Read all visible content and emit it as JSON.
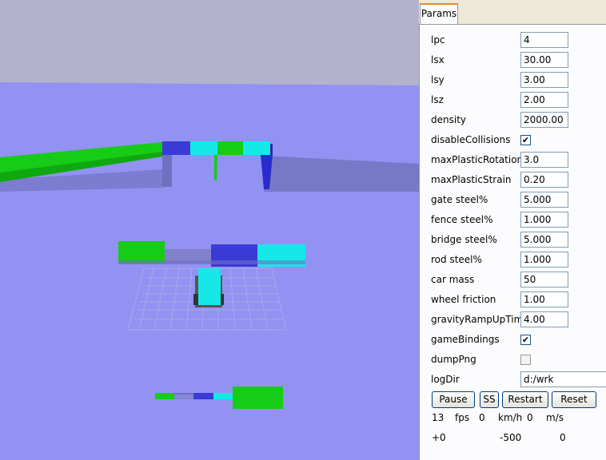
{
  "panel": {
    "tab_label": "Params",
    "params": [
      {
        "label": "lpc",
        "value": "4"
      },
      {
        "label": "lsx",
        "value": "30.00"
      },
      {
        "label": "lsy",
        "value": "3.00"
      },
      {
        "label": "lsz",
        "value": "2.00"
      },
      {
        "label": "density",
        "value": "2000.00"
      },
      {
        "label": "disableCollisions",
        "checked": true
      },
      {
        "label": "maxPlasticRotation",
        "value": "3.0"
      },
      {
        "label": "maxPlasticStrain",
        "value": "0.20"
      },
      {
        "label": "gate steel%",
        "value": "5.000"
      },
      {
        "label": "fence steel%",
        "value": "1.000"
      },
      {
        "label": "bridge steel%",
        "value": "5.000"
      },
      {
        "label": "rod steel%",
        "value": "1.000"
      },
      {
        "label": "car mass",
        "value": "50"
      },
      {
        "label": "wheel friction",
        "value": "1.00"
      },
      {
        "label": "gravityRampUpTime",
        "value": "4.00"
      },
      {
        "label": "gameBindings",
        "checked": true
      },
      {
        "label": "dumpPng",
        "checked": false
      },
      {
        "label": "logDir",
        "value": "d:/wrk"
      }
    ],
    "buttons": {
      "pause": "Pause",
      "ss": "SS",
      "restart": "Restart",
      "reset": "Reset"
    },
    "status1": {
      "fps_value": "13",
      "fps_unit": "fps",
      "speed_kmh": "0",
      "kmh_unit": "km/h",
      "speed_ms": "0",
      "ms_unit": "m/s"
    },
    "status2": {
      "a": "+0",
      "b": "-500",
      "c": "0"
    }
  },
  "colors": {
    "sky": "#b2b2cc",
    "ground": "#9292f2",
    "green": "#16cc16",
    "blue": "#3a3ad6",
    "cyan": "#16e8e8",
    "shadow": "#7878c8",
    "panel_bg": "#ece9d8"
  }
}
